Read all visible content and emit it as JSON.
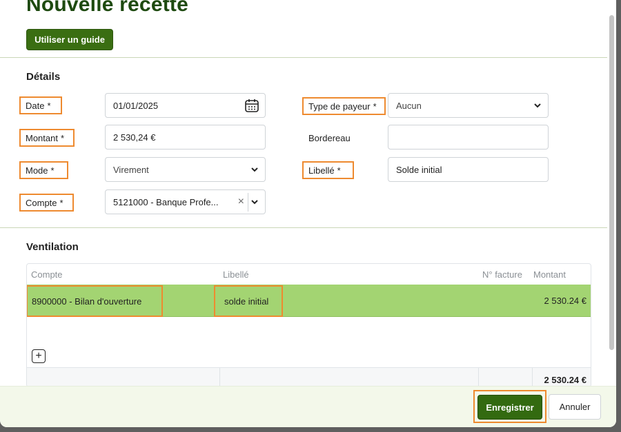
{
  "dialog": {
    "title": "Nouvelle recette",
    "guide_button": "Utiliser un guide"
  },
  "details": {
    "section_title": "Détails",
    "date": {
      "label": "Date",
      "required": "*",
      "value": "01/01/2025",
      "icon": "calendar-icon"
    },
    "montant": {
      "label": "Montant",
      "required": "*",
      "value": "2 530,24 €"
    },
    "mode": {
      "label": "Mode",
      "required": "*",
      "value": "Virement"
    },
    "compte": {
      "label": "Compte",
      "required": "*",
      "value": "5121000 - Banque Profe..."
    },
    "type_payeur": {
      "label": "Type de payeur",
      "required": "*",
      "value": "Aucun"
    },
    "bordereau": {
      "label": "Bordereau",
      "value": ""
    },
    "libelle": {
      "label": "Libellé",
      "required": "*",
      "value": "Solde initial"
    }
  },
  "ventilation": {
    "section_title": "Ventilation",
    "columns": [
      "Compte",
      "Libellé",
      "N° facture",
      "Montant"
    ],
    "rows": [
      {
        "compte": "8900000 - Bilan d'ouverture",
        "libelle": "solde initial",
        "facture": "",
        "montant": "2 530.24 €"
      }
    ],
    "total": "2 530.24 €"
  },
  "footer": {
    "save_button": "Enregistrer",
    "cancel_button": "Annuler"
  },
  "colors": {
    "brand_green": "#3a6e12",
    "row_highlight": "#a3d472",
    "annotation_orange": "#ee8a2f"
  }
}
